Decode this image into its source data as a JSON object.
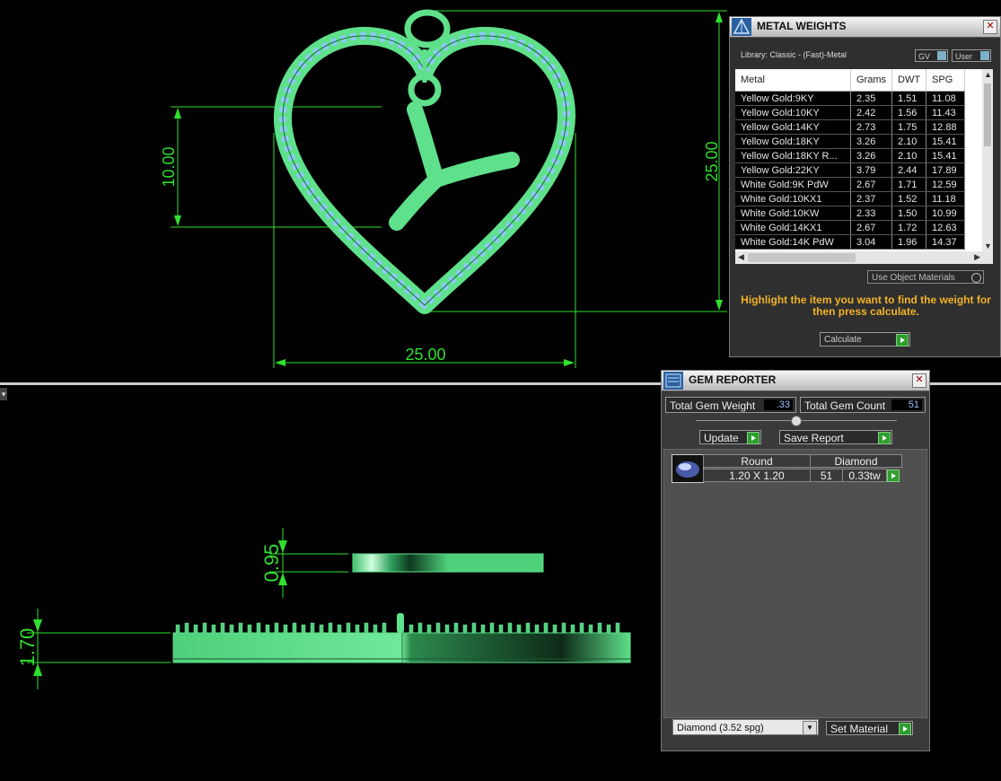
{
  "viewport_top": {
    "dim_width": "25.00",
    "dim_height": "25.00",
    "dim_arm": "10.00"
  },
  "viewport_bottom": {
    "dim_plate": "0.95",
    "dim_side": "1.70"
  },
  "metal_weights": {
    "title": "METAL WEIGHTS",
    "library": "Library: Classic - (Fast)-Metal",
    "gv_label": "GV",
    "user_label": "User",
    "columns": [
      "Metal",
      "Grams",
      "DWT",
      "SPG"
    ],
    "rows": [
      [
        "Yellow Gold:9KY",
        "2.35",
        "1.51",
        "11.08"
      ],
      [
        "Yellow Gold:10KY",
        "2.42",
        "1.56",
        "11.43"
      ],
      [
        "Yellow Gold:14KY",
        "2.73",
        "1.75",
        "12.88"
      ],
      [
        "Yellow Gold:18KY",
        "3.26",
        "2.10",
        "15.41"
      ],
      [
        "Yellow Gold:18KY R...",
        "3.26",
        "2.10",
        "15.41"
      ],
      [
        "Yellow Gold:22KY",
        "3.79",
        "2.44",
        "17.89"
      ],
      [
        "White Gold:9K PdW",
        "2.67",
        "1.71",
        "12.59"
      ],
      [
        "White Gold:10KX1",
        "2.37",
        "1.52",
        "11.18"
      ],
      [
        "White Gold:10KW",
        "2.33",
        "1.50",
        "10.99"
      ],
      [
        "White Gold:14KX1",
        "2.67",
        "1.72",
        "12.63"
      ],
      [
        "White Gold:14K PdW",
        "3.04",
        "1.96",
        "14.37"
      ]
    ],
    "use_object_materials": "Use Object Materials",
    "help_text": "Highlight the item you want to find the weight for then press calculate.",
    "calculate_label": "Calculate"
  },
  "gem_reporter": {
    "title": "GEM REPORTER",
    "total_weight_label": "Total Gem Weight",
    "total_weight_value": ".33",
    "total_count_label": "Total Gem Count",
    "total_count_value": "51",
    "update_label": "Update",
    "save_report_label": "Save Report",
    "gem_rows": [
      {
        "shape": "Round",
        "type": "Diamond",
        "size": "1.20 X 1.20",
        "count": "51",
        "weight": "0.33tw"
      }
    ],
    "material_select": "Diamond    (3.52 spg)",
    "set_material_label": "Set Material"
  },
  "colors": {
    "model_green": "#5fe08a",
    "dimension_green": "#2fe02f",
    "stone_blue": "#8fc8f8",
    "help_orange": "#f2b226"
  },
  "icons": [
    "metal-weights-icon",
    "gem-reporter-icon",
    "close-icon",
    "calculate-go-icon",
    "diamond-thumbnail-icon"
  ]
}
